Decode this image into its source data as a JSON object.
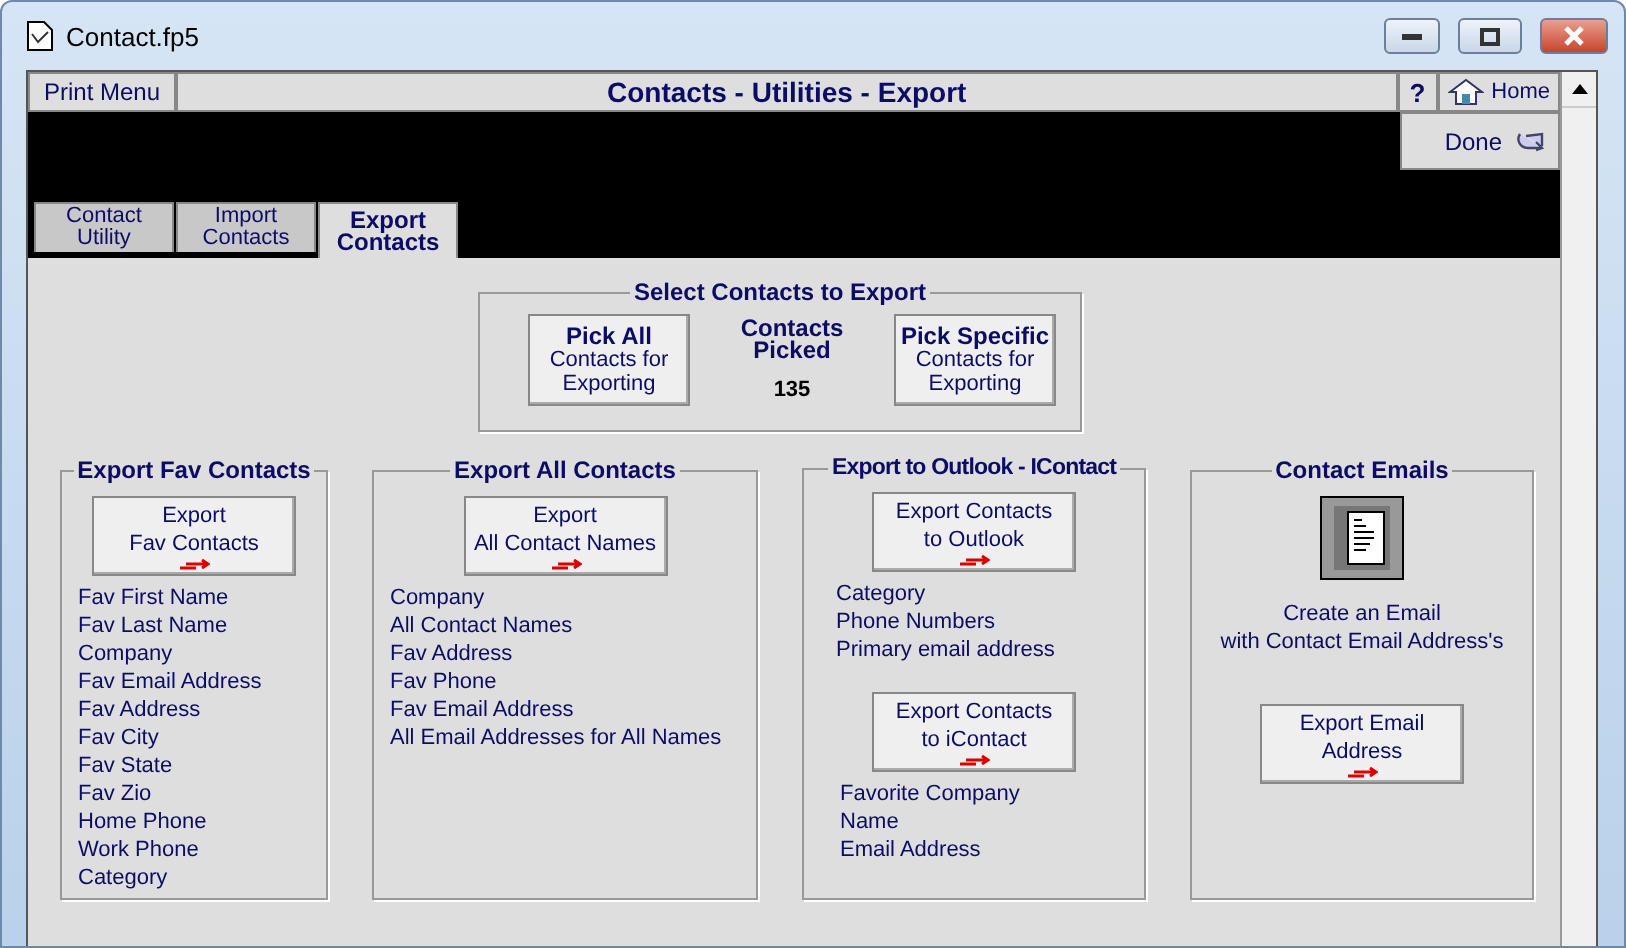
{
  "window": {
    "title": "Contact.fp5"
  },
  "header": {
    "print_menu": "Print Menu",
    "title": "Contacts - Utilities - Export",
    "help": "?",
    "home": "Home",
    "done": "Done"
  },
  "tabs": [
    {
      "lines": [
        "Contact",
        "Utility"
      ],
      "selected": false
    },
    {
      "lines": [
        "Import",
        "Contacts"
      ],
      "selected": false
    },
    {
      "lines": [
        "Export",
        "Contacts"
      ],
      "selected": true
    }
  ],
  "select_contacts": {
    "title": "Select Contacts to Export",
    "pick_all": {
      "heading": "Pick All",
      "lines": [
        "Contacts for",
        "Exporting"
      ]
    },
    "picked_label": [
      "Contacts",
      "Picked"
    ],
    "picked_count": "135",
    "pick_specific": {
      "heading": "Pick Specific",
      "lines": [
        "Contacts for",
        "Exporting"
      ]
    }
  },
  "groups": [
    {
      "title": "Export Fav Contacts",
      "items": [
        {
          "kind": "export",
          "button": [
            "Export",
            "Fav Contacts"
          ],
          "fields": [
            "Fav First Name",
            "Fav Last Name",
            "Company",
            "Fav Email Address",
            "Fav Address",
            "Fav City",
            "Fav State",
            "Fav Zio",
            "Home Phone",
            "Work Phone",
            "Category"
          ]
        }
      ]
    },
    {
      "title": "Export All Contacts",
      "items": [
        {
          "kind": "export",
          "button": [
            "Export",
            "All Contact Names"
          ],
          "fields": [
            "Company",
            "All Contact Names",
            "Fav Address",
            "Fav Phone",
            "Fav Email Address",
            "All Email Addresses for All Names"
          ]
        }
      ]
    },
    {
      "title": "Export to Outlook - IContact",
      "items": [
        {
          "kind": "export",
          "button": [
            "Export Contacts",
            "to Outlook"
          ],
          "fields": [
            "Category",
            "Phone Numbers",
            "Primary email address"
          ]
        },
        {
          "kind": "export",
          "button": [
            "Export Contacts",
            "to iContact"
          ],
          "fields": [
            "Favorite Company",
            "Name",
            "Email Address"
          ]
        }
      ]
    },
    {
      "title": "Contact Emails",
      "items": [
        {
          "kind": "email",
          "caption": [
            "Create an Email",
            "with Contact Email Address's"
          ]
        },
        {
          "kind": "export",
          "button": [
            "Export Email",
            "Address"
          ]
        }
      ]
    }
  ]
}
